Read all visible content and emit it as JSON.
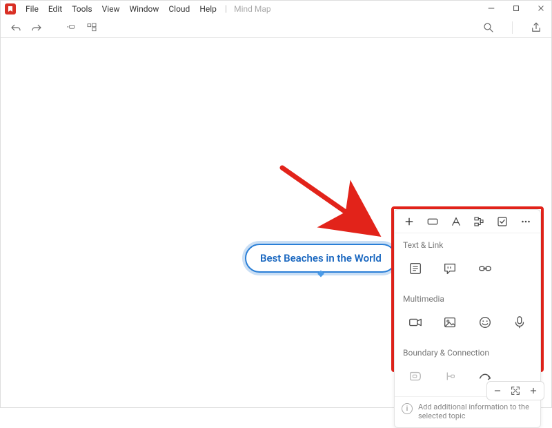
{
  "menubar": {
    "items": [
      "File",
      "Edit",
      "Tools",
      "View",
      "Window",
      "Cloud",
      "Help"
    ],
    "doc_title": "Mind Map"
  },
  "topic": {
    "central_label": "Best Beaches in the World"
  },
  "panel": {
    "tabs": {
      "add": "add",
      "shape": "shape",
      "text": "text",
      "tree": "tree",
      "checklist": "checklist",
      "more": "more"
    },
    "sections": {
      "text_link": {
        "title": "Text & Link",
        "items": [
          "note",
          "comment",
          "link"
        ]
      },
      "multimedia": {
        "title": "Multimedia",
        "items": [
          "video",
          "image",
          "emoji",
          "audio"
        ]
      },
      "boundary_connection": {
        "title": "Boundary & Connection",
        "items": [
          "boundary",
          "summary",
          "relationship"
        ]
      }
    },
    "info_text": "Add additional information to the selected topic"
  },
  "colors": {
    "highlight_red": "#e2231a",
    "topic_blue": "#2a7fd7"
  }
}
